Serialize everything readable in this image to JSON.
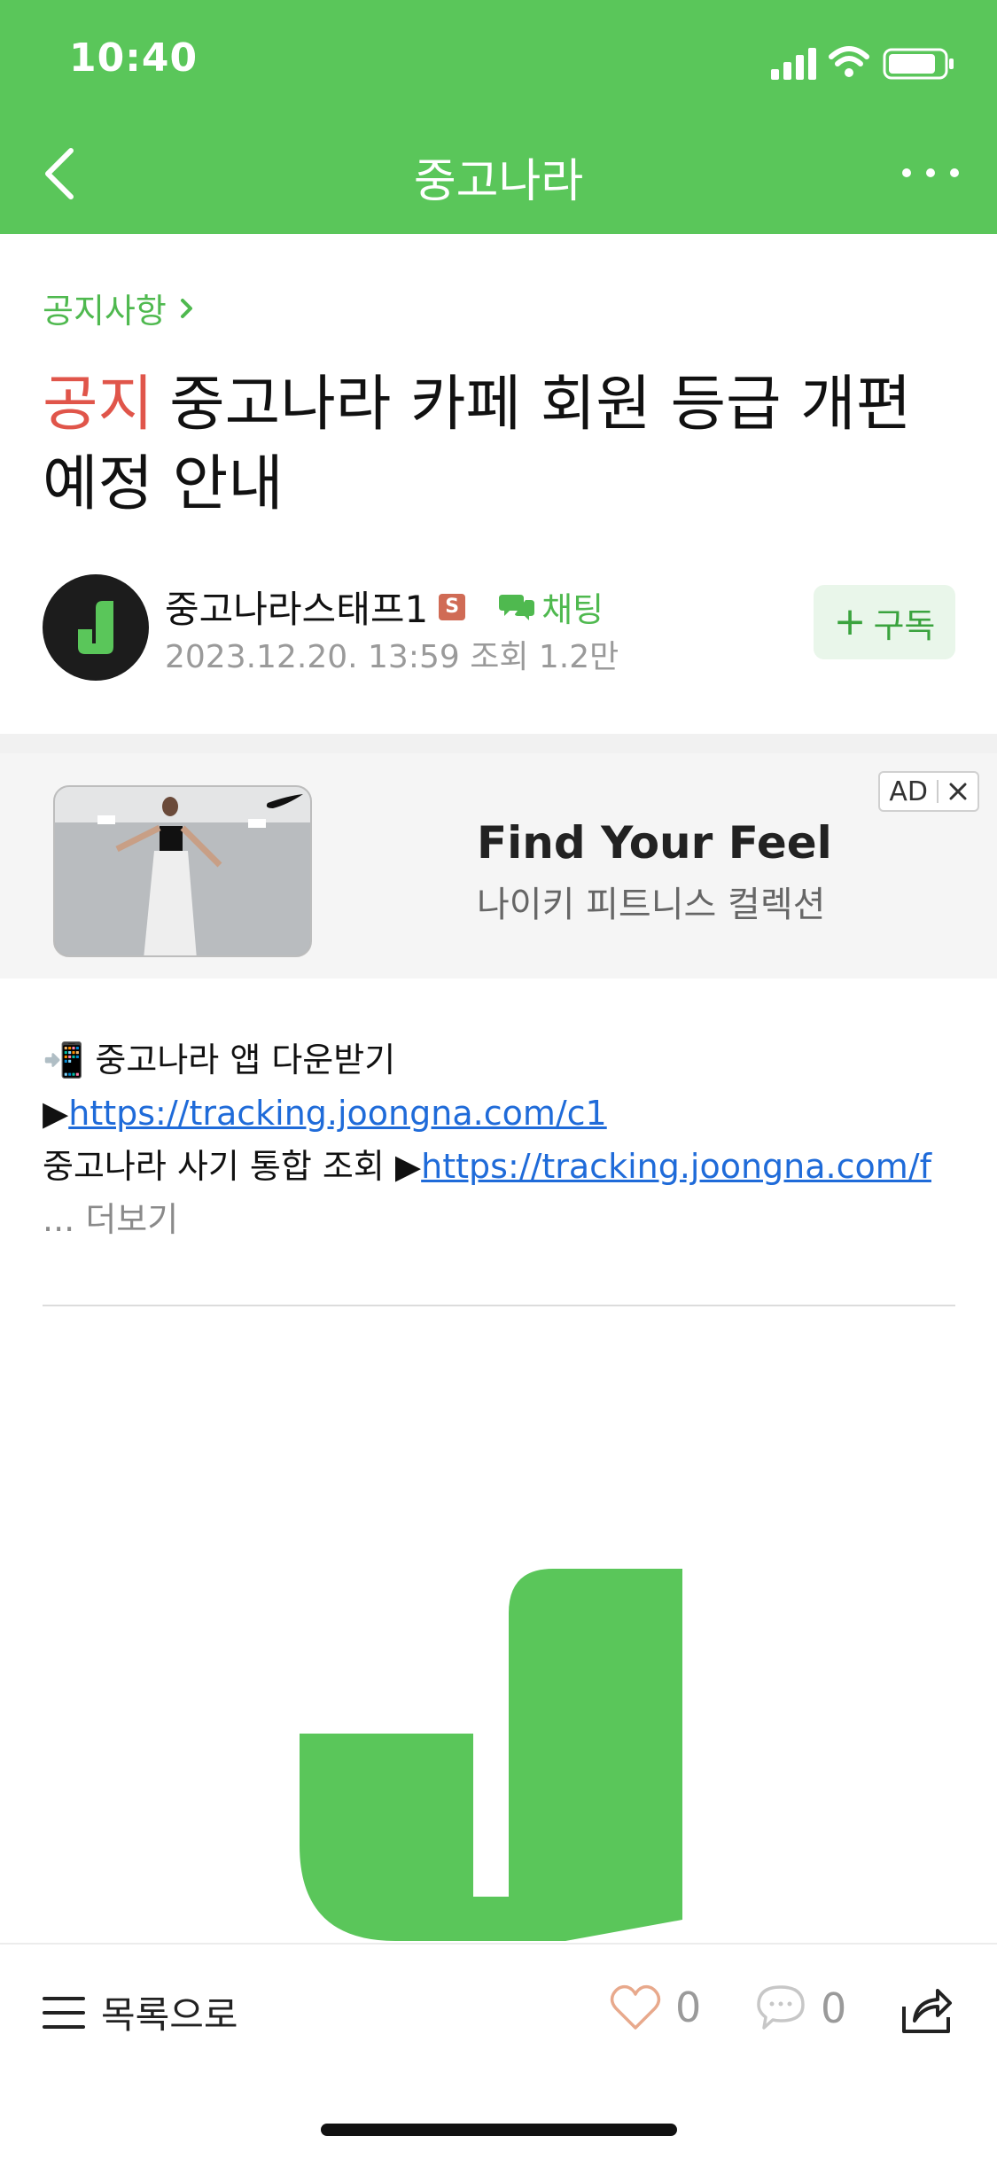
{
  "status_bar": {
    "time": "10:40"
  },
  "nav": {
    "title": "중고나라"
  },
  "post": {
    "breadcrumb": "공지사항",
    "tag": "공지",
    "title": "중고나라 카페 회원 등급 개편 예정 안내",
    "author": "중고나라스태프1",
    "staff_badge": "S",
    "chat_label": "채팅",
    "meta": "2023.12.20. 13:59 조회 1.2만",
    "subscribe_label": "구독"
  },
  "ad": {
    "headline": "Find Your Feel",
    "subtitle": "나이키 피트니스 컬렉션",
    "label": "AD"
  },
  "content": {
    "line1_prefix": "📲 중고나라 앱 다운받기 ▶",
    "line1_link": "https://tracking.joongna.com/c1",
    "line2_prefix": "중고나라 사기 통합 조회 ▶",
    "line2_link": "https://tracking.joongna.com/f",
    "more": "... 더보기"
  },
  "bottom_bar": {
    "list_label": "목록으로",
    "like_count": "0",
    "comment_count": "0"
  },
  "colors": {
    "brand_green": "#5ac65a",
    "notice_red": "#e0554a",
    "link_blue": "#1f6bd9"
  }
}
